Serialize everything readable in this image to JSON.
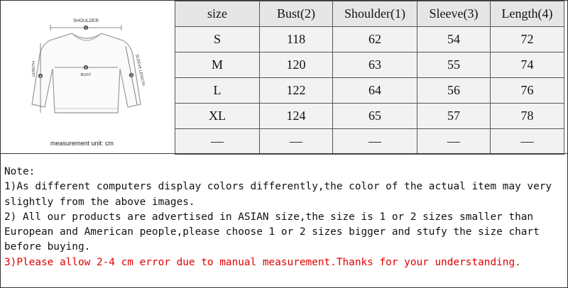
{
  "diagram": {
    "shoulder_label": "SHOULDER",
    "bust_label": "BUST",
    "length_label": "LENGTH",
    "sleeve_label": "SLEEVE LENGTH",
    "marker_1": "1",
    "marker_2": "2",
    "marker_3": "3",
    "marker_4": "4",
    "unit_caption": "measurement unit: cm"
  },
  "table": {
    "headers": [
      "size",
      "Bust(2)",
      "Shoulder(1)",
      "Sleeve(3)",
      "Length(4)"
    ],
    "rows": [
      [
        "S",
        "118",
        "62",
        "54",
        "72"
      ],
      [
        "M",
        "120",
        "63",
        "55",
        "74"
      ],
      [
        "L",
        "122",
        "64",
        "56",
        "76"
      ],
      [
        "XL",
        "124",
        "65",
        "57",
        "78"
      ],
      [
        "—",
        "—",
        "—",
        "—",
        "—"
      ]
    ]
  },
  "notes": {
    "title": "Note:",
    "line1": "1)As different computers display colors differently,the color of the actual item may very slightly from the above images.",
    "line2": "2) All our products are advertised in ASIAN size,the size is 1 or 2 sizes smaller than European and American people,please choose 1 or 2 sizes bigger and stufy the size chart before buying.",
    "line3": "3)Please allow 2-4 cm error due to manual measurement.Thanks for your understanding.",
    "warn_color": "#e00000"
  }
}
